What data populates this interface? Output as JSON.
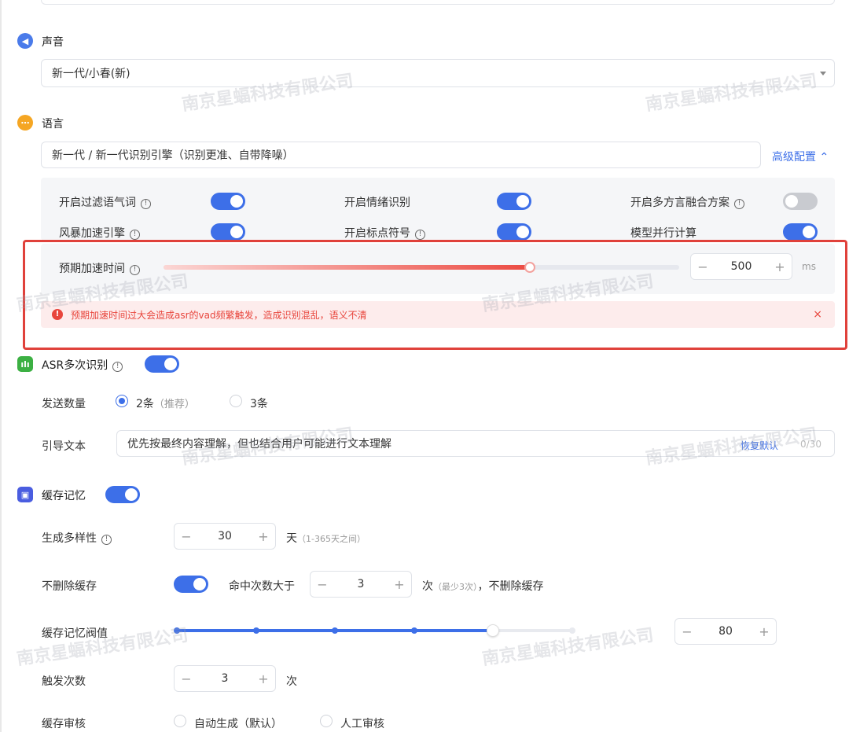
{
  "voice": {
    "title": "声音",
    "selected": "新一代/小春(新)"
  },
  "language": {
    "title": "语言",
    "selected": "新一代 / 新一代识别引擎（识别更准、自带降噪）",
    "advanced_link": "高级配置 ⌃",
    "options": [
      {
        "label": "开启过滤语气词",
        "info": true,
        "enabled": true
      },
      {
        "label": "开启情绪识别",
        "info": false,
        "enabled": true
      },
      {
        "label": "开启多方言融合方案",
        "info": true,
        "enabled": false
      },
      {
        "label": "风暴加速引擎",
        "info": true,
        "enabled": true
      },
      {
        "label": "开启标点符号",
        "info": true,
        "enabled": true
      },
      {
        "label": "模型并行计算",
        "info": false,
        "enabled": true
      }
    ],
    "accel": {
      "label": "预期加速时间",
      "value": "500",
      "unit": "ms",
      "level": 0.71,
      "minus": "−",
      "plus": "+"
    },
    "alert": {
      "text": "预期加速时间过大会造成asr的vad频繁触发，造成识别混乱，语义不清",
      "icon": "!",
      "close": "×"
    }
  },
  "asr": {
    "title": "ASR多次识别",
    "enabled": true,
    "send_count_label": "发送数量",
    "options": [
      {
        "label": "2条",
        "hint": "（推荐）",
        "selected": true
      },
      {
        "label": "3条",
        "hint": "",
        "selected": false
      }
    ],
    "guide_label": "引导文本",
    "guide_value": "优先按最终内容理解，但也结合用户可能进行文本理解",
    "restore_link": "恢复默认",
    "counter": "0/30"
  },
  "cache": {
    "title": "缓存记忆",
    "enabled": true,
    "diversity_label": "生成多样性",
    "diversity_value": "30",
    "diversity_unit": "天",
    "diversity_hint": "（1-365天之间）",
    "no_delete_label": "不删除缓存",
    "no_delete_enabled": true,
    "hit_label": "命中次数大于",
    "hit_value": "3",
    "hit_unit": "次",
    "hit_hint": "（最少3次）",
    "hit_suffix": "，不删除缓存",
    "threshold_label": "缓存记忆阀值",
    "threshold_value": "80",
    "threshold_level": 0.8,
    "trigger_label": "触发次数",
    "trigger_value": "3",
    "trigger_unit": "次",
    "review_label": "缓存审核",
    "review_options": [
      {
        "label": "自动生成（默认）",
        "selected": false
      },
      {
        "label": "人工审核",
        "selected": false
      }
    ],
    "minus": "−",
    "plus": "+"
  },
  "watermark": "南京星蝠科技有限公司",
  "colors": {
    "accent": "#3d6fe8",
    "danger": "#e0413b",
    "voice_icon": "#4a7bea",
    "language_icon": "#f5a623",
    "asr_icon": "#3cb043",
    "cache_icon": "#4a5de0"
  }
}
